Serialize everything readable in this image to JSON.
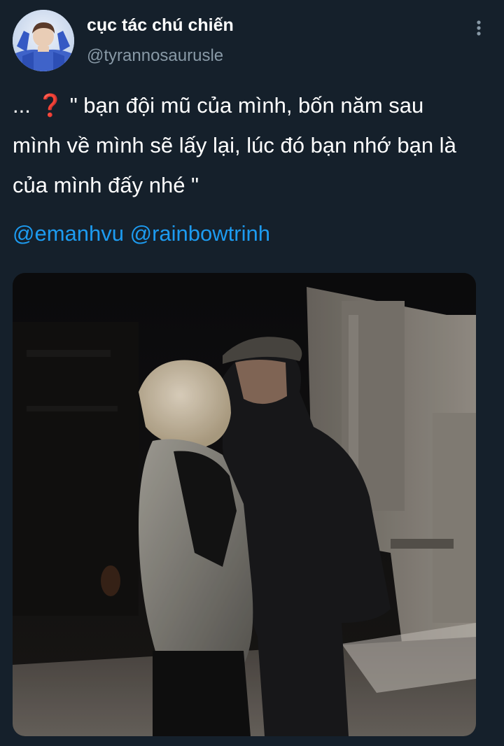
{
  "tweet": {
    "display_name": "cục tác chú chiến",
    "handle": "@tyrannosaurusle",
    "text_prefix": "...",
    "question_glyph": "❓",
    "text_line1": " \" bạn đội mũ của mình, bốn năm sau",
    "text_line2": "mình về mình sẽ lấy lại, lúc đó bạn nhớ bạn là",
    "text_line3": "của mình đấy nhé \"",
    "mentions": [
      "@emanhvu",
      "@rainbowtrinh"
    ]
  },
  "icons": {
    "more": "more-vertical-icon",
    "avatar": "profile-avatar"
  },
  "colors": {
    "background": "#15202b",
    "text": "#ffffff",
    "secondary": "#8899a6",
    "link": "#1d9bf0",
    "question_mark": "#e0202c"
  }
}
